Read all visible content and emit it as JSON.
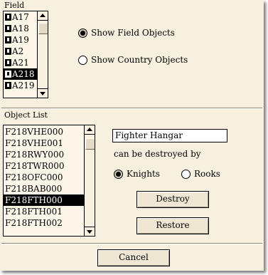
{
  "field_section": {
    "title": "Field",
    "items": [
      "A17",
      "A18",
      "A19",
      "A2",
      "A21",
      "A218",
      "A219"
    ],
    "selected_index": 5,
    "scroll_fraction": 0.05,
    "radio_field_label": "Show Field Objects",
    "radio_country_label": "Show Country Objects",
    "selected_radio": "field"
  },
  "object_section": {
    "title": "Object List",
    "items": [
      "F218VHE000",
      "F218VHE001",
      "F218RWY000",
      "F218TWR000",
      "F218OFC000",
      "F218BAB000",
      "F218FTH000",
      "F218FTH001",
      "F218FTH002"
    ],
    "selected_index": 6,
    "scroll_fraction": 0.05,
    "object_name": "Fighter Hangar",
    "destroyed_by_label": "can be destroyed by",
    "radio_knights_label": "Knights",
    "radio_rooks_label": "Rooks",
    "selected_side": "knights",
    "destroy_label": "Destroy",
    "restore_label": "Restore"
  },
  "footer": {
    "cancel_label": "Cancel"
  }
}
